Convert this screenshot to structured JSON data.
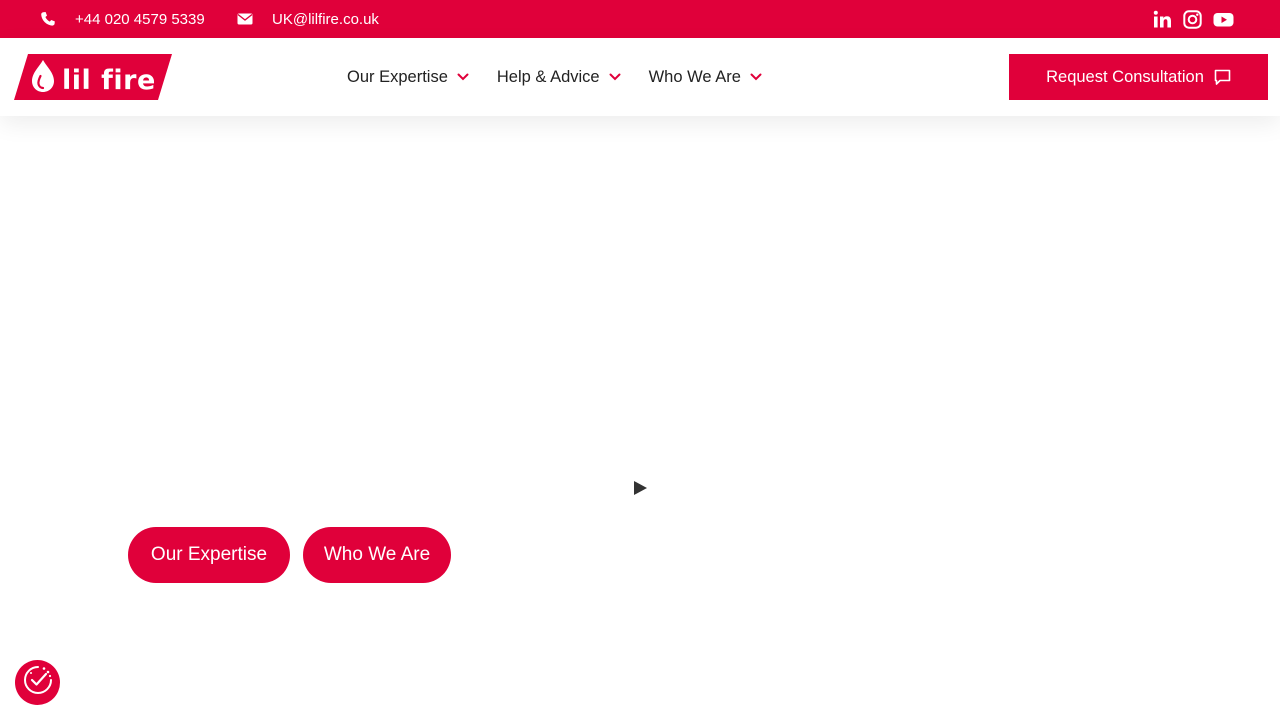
{
  "topbar": {
    "phone": "+44 020 4579 5339",
    "email": "UK@lilfire.co.uk",
    "icons": [
      "phone-icon",
      "envelope-icon",
      "linkedin-icon",
      "instagram-icon",
      "youtube-icon"
    ]
  },
  "brand": {
    "name": "lil fire",
    "accent": "#e0003a"
  },
  "nav": {
    "items": [
      {
        "label": "Our Expertise"
      },
      {
        "label": "Help & Advice"
      },
      {
        "label": "Who We Are"
      }
    ]
  },
  "cta": {
    "label": "Request Consultation",
    "icon": "chat-icon"
  },
  "hero": {
    "buttons": [
      {
        "label": "Our Expertise"
      },
      {
        "label": "Who We Are"
      }
    ],
    "play_icon": "play-icon"
  },
  "badge": {
    "icon": "consent-check-icon"
  }
}
